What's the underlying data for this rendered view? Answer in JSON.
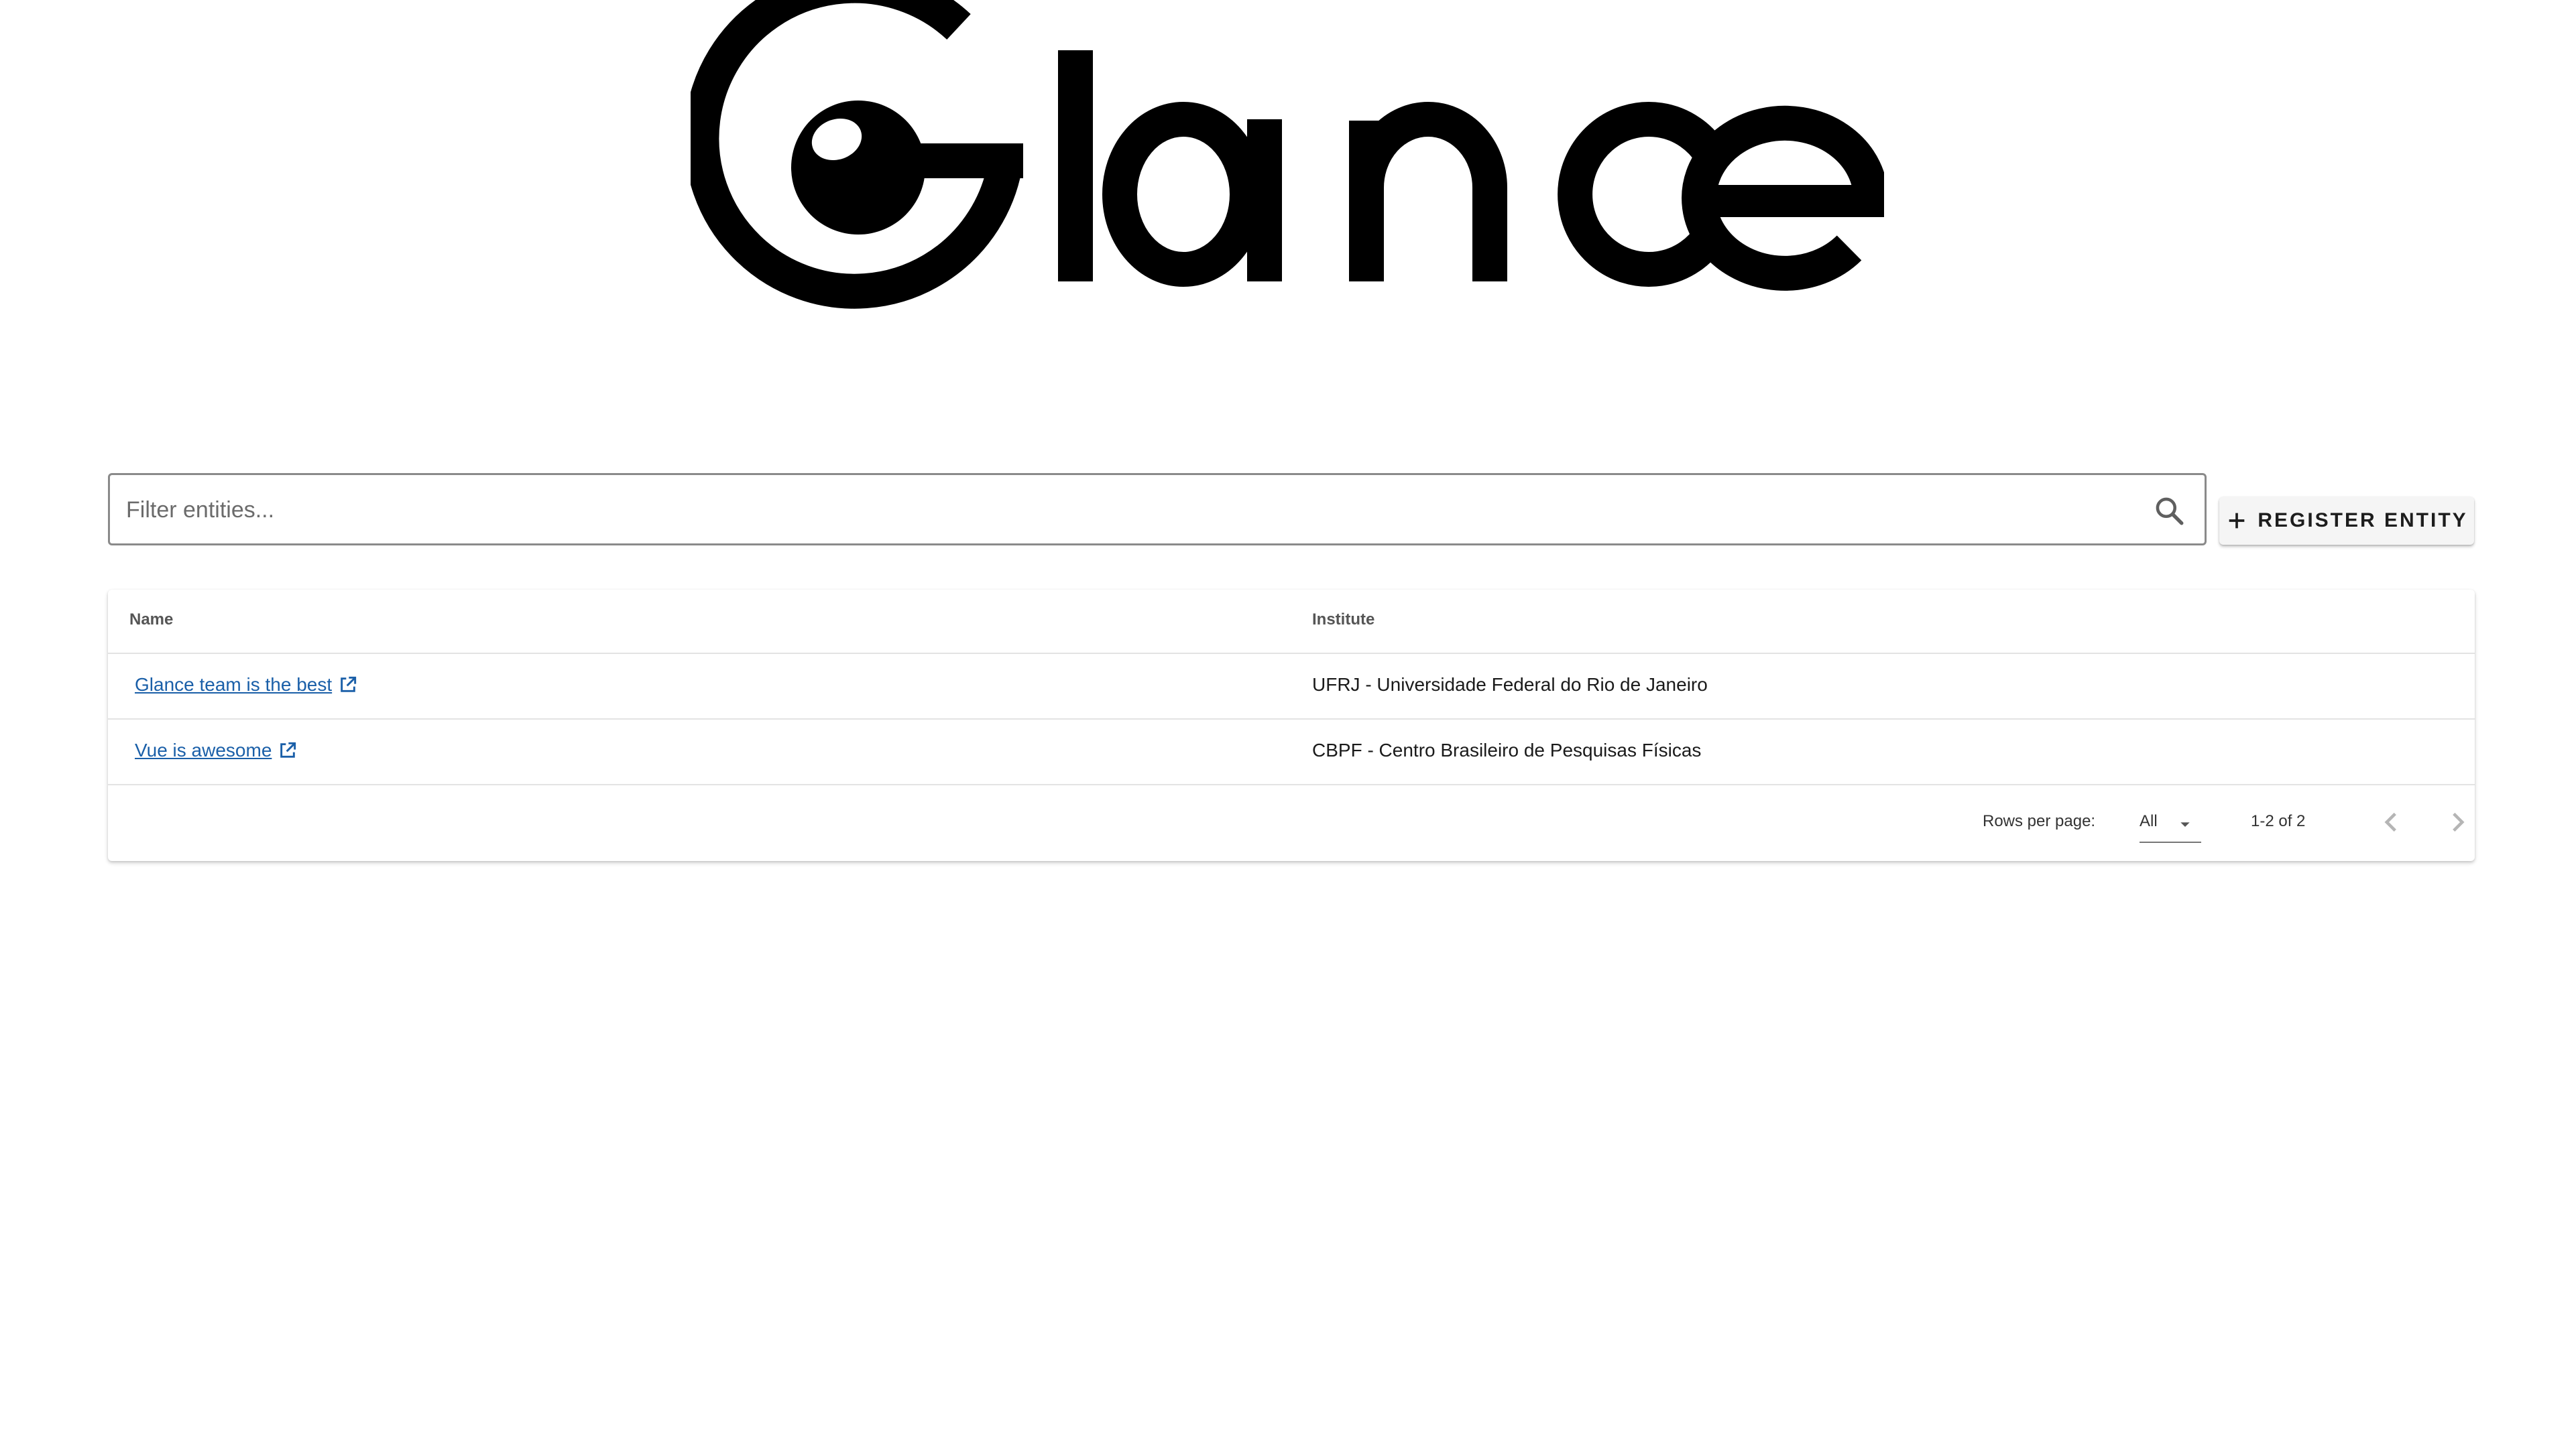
{
  "logo": {
    "wordmark": "Glance"
  },
  "filter": {
    "placeholder": "Filter entities...",
    "value": "",
    "icon": "search-icon"
  },
  "register_button": {
    "label": "REGISTER ENTITY",
    "icon": "plus-icon"
  },
  "table": {
    "columns": [
      "Name",
      "Institute"
    ],
    "rows": [
      {
        "name": "Glance team is the best",
        "institute": "UFRJ - Universidade Federal do Rio de Janeiro",
        "icon": "external-link-icon"
      },
      {
        "name": "Vue is awesome",
        "institute": "CBPF - Centro Brasileiro de Pesquisas Físicas",
        "icon": "external-link-icon"
      }
    ],
    "footer": {
      "rows_per_page_label": "Rows per page:",
      "rows_per_page_value": "All",
      "range_text": "1-2 of 2"
    }
  },
  "colors": {
    "link": "#1a5fa8",
    "logo": "#000000",
    "border": "#8a8a8a"
  }
}
